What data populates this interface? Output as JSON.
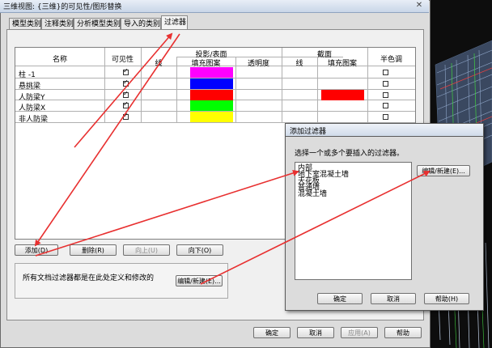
{
  "main_dialog": {
    "title": "三维视图: {三维}的可见性/图形替换",
    "close_glyph": "✕",
    "tabs": [
      "模型类别",
      "注释类别",
      "分析模型类别",
      "导入的类别",
      "过滤器"
    ],
    "active_tab": "过滤器",
    "grid": {
      "headers": {
        "name": "名称",
        "visibility": "可见性",
        "projection_surface": "投影/表面",
        "line": "线",
        "fill_pattern": "填充图案",
        "transparency": "透明度",
        "section": "截面",
        "section_line": "线",
        "section_fill_pattern": "填充图案",
        "halftone": "半色调"
      },
      "rows": [
        {
          "name": "柱 -1",
          "visible": true,
          "fill_color": "#ff00ff",
          "section_fill_color": "",
          "halftone": false
        },
        {
          "name": "悬挑梁",
          "visible": true,
          "fill_color": "#0000ff",
          "section_fill_color": "",
          "halftone": false
        },
        {
          "name": "人防梁Y",
          "visible": true,
          "fill_color": "#ff0000",
          "section_fill_color": "#ff0000",
          "halftone": false
        },
        {
          "name": "人防梁X",
          "visible": true,
          "fill_color": "#00ff00",
          "section_fill_color": "",
          "halftone": false
        },
        {
          "name": "非人防梁",
          "visible": true,
          "fill_color": "#ffff00",
          "section_fill_color": "",
          "halftone": false
        }
      ]
    },
    "buttons": {
      "add": "添加(D)",
      "delete": "删除(R)",
      "up": "向上(U)",
      "down": "向下(O)",
      "edit_new": "编辑/新建(E)...",
      "ok": "确定",
      "cancel": "取消",
      "apply": "应用(A)",
      "help": "帮助"
    },
    "info_text": "所有文档过滤器都是在此处定义和修改的"
  },
  "add_filter_dialog": {
    "title": "添加过滤器",
    "prompt": "选择一个或多个要插入的过滤器。",
    "items": [
      "内部",
      "地下室混凝土墙",
      "天花板",
      "普通墙",
      "混凝土墙"
    ],
    "buttons": {
      "edit_new": "编辑/新建(E)...",
      "ok": "确定",
      "cancel": "取消",
      "help": "帮助(H)"
    }
  },
  "colors": {
    "arrow": "#e83030"
  }
}
